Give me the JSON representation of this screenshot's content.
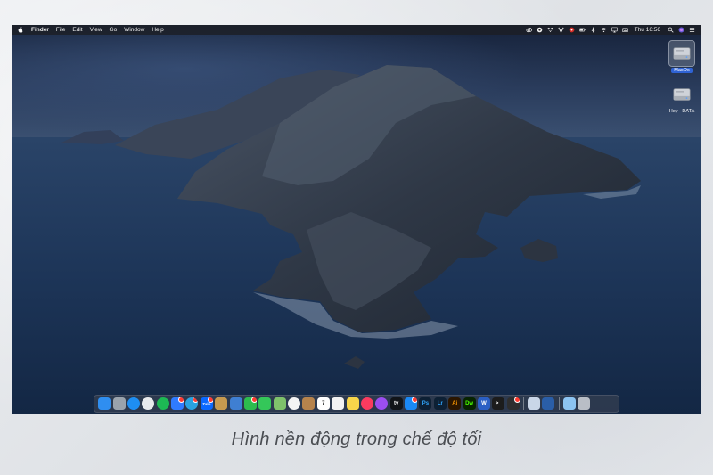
{
  "menubar": {
    "app_name": "Finder",
    "menus": [
      "File",
      "Edit",
      "View",
      "Go",
      "Window",
      "Help"
    ],
    "status_icons": [
      "creative-cloud-icon",
      "vpn-icon",
      "dropbox-icon",
      "vnc-icon",
      "lastpass-icon",
      "battery-icon",
      "bluetooth-icon",
      "wifi-icon",
      "airplay-icon",
      "keyboard-icon"
    ],
    "clock": "Thu 16:56"
  },
  "desktop": {
    "icons": [
      {
        "label": "MacOs",
        "selected": true
      },
      {
        "label": "Hey - DATA",
        "selected": false
      }
    ]
  },
  "dock": {
    "apps": [
      {
        "name": "finder",
        "bg": "#2f8ef0",
        "text": ""
      },
      {
        "name": "launchpad",
        "bg": "#9aa3ad",
        "text": ""
      },
      {
        "name": "safari",
        "bg": "#1e8ef2",
        "text": ""
      },
      {
        "name": "chrome",
        "bg": "#e8eaed",
        "text": ""
      },
      {
        "name": "spotify",
        "bg": "#1db954",
        "text": ""
      },
      {
        "name": "messenger",
        "bg": "#2f7bff",
        "text": "",
        "badge": true
      },
      {
        "name": "telegram",
        "bg": "#2aa3e0",
        "text": "",
        "badge": true
      },
      {
        "name": "zalo",
        "bg": "#0a68ff",
        "text": "Zalo",
        "badge": true
      },
      {
        "name": "preview",
        "bg": "#c79a4f",
        "text": ""
      },
      {
        "name": "photo-app",
        "bg": "#3f7fd2",
        "text": ""
      },
      {
        "name": "facetime",
        "bg": "#2dbc4e",
        "text": "",
        "badge": true
      },
      {
        "name": "messages",
        "bg": "#34c759",
        "text": ""
      },
      {
        "name": "maps",
        "bg": "#7fc26b",
        "text": ""
      },
      {
        "name": "photos",
        "bg": "#f4f4f4",
        "text": ""
      },
      {
        "name": "contacts",
        "bg": "#b6834c",
        "text": ""
      },
      {
        "name": "calendar",
        "bg": "#ffffff",
        "text": "7"
      },
      {
        "name": "reminders",
        "bg": "#f2f2f2",
        "text": ""
      },
      {
        "name": "notes",
        "bg": "#f7d54a",
        "text": ""
      },
      {
        "name": "music",
        "bg": "#fb3b5f",
        "text": ""
      },
      {
        "name": "podcasts",
        "bg": "#9b4ef0",
        "text": ""
      },
      {
        "name": "tv",
        "bg": "#111418",
        "text": "tv"
      },
      {
        "name": "app-store",
        "bg": "#1a88f5",
        "text": "",
        "badge": true
      },
      {
        "name": "photoshop",
        "bg": "#0d2034",
        "text": "Ps",
        "fg": "#31a8ff"
      },
      {
        "name": "lightroom",
        "bg": "#0d2034",
        "text": "Lr",
        "fg": "#31a8ff"
      },
      {
        "name": "illustrator",
        "bg": "#2b1600",
        "text": "Ai",
        "fg": "#ff9a00"
      },
      {
        "name": "dreamweaver",
        "bg": "#072401",
        "text": "Dw",
        "fg": "#4afe00"
      },
      {
        "name": "word",
        "bg": "#2b5fc4",
        "text": "W"
      },
      {
        "name": "terminal",
        "bg": "#1c1c1c",
        "text": ">_"
      },
      {
        "name": "activity-monitor",
        "bg": "#2e2e2e",
        "text": "",
        "badge": true
      }
    ],
    "extras": [
      {
        "name": "downloads-stack",
        "bg": "#c9d6e8",
        "text": ""
      },
      {
        "name": "browser-stack",
        "bg": "#2a5ea8",
        "text": ""
      }
    ],
    "tail": [
      {
        "name": "folder",
        "bg": "#8cc4f2",
        "text": ""
      },
      {
        "name": "trash",
        "bg": "#b9bec6",
        "text": ""
      }
    ]
  },
  "caption": "Hình nền động trong chế độ tối"
}
